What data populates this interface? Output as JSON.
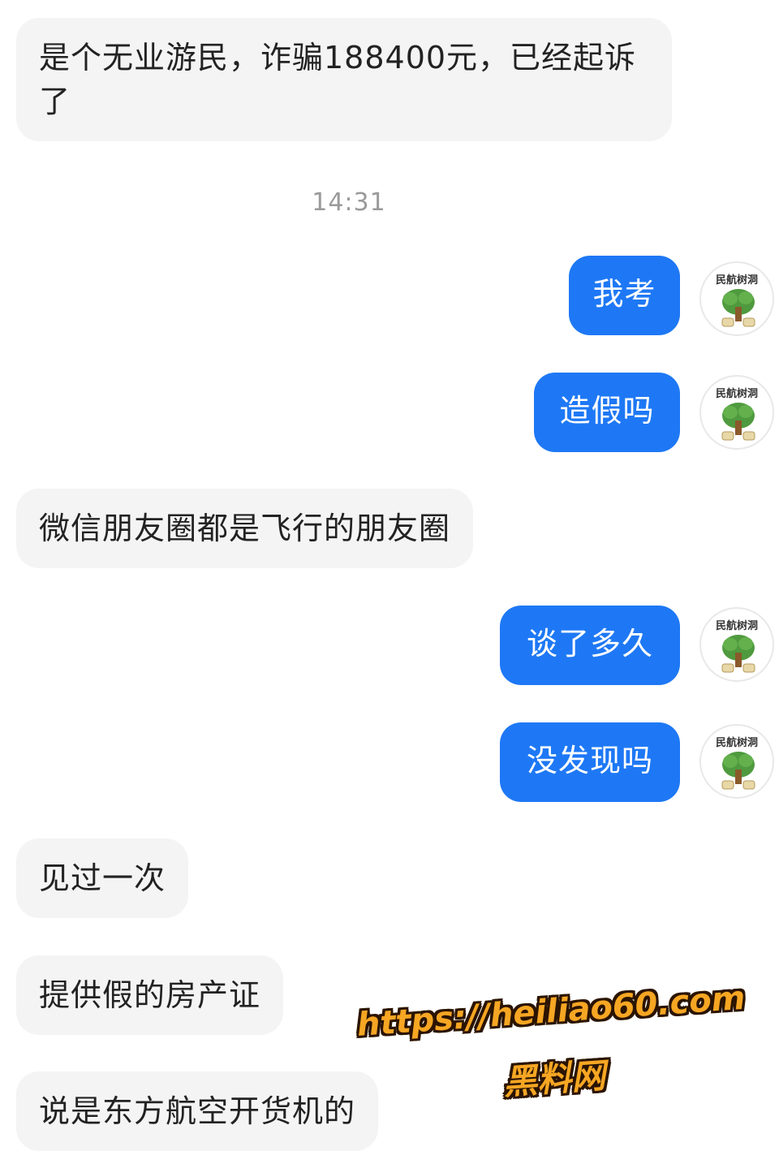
{
  "messages": [
    {
      "id": "m1",
      "side": "in",
      "text": "是个无业游民，诈骗188400元，已经起诉了"
    },
    {
      "id": "ts",
      "type": "timestamp",
      "text": "14:31"
    },
    {
      "id": "m2",
      "side": "out",
      "text": "我考"
    },
    {
      "id": "m3",
      "side": "out",
      "text": "造假吗"
    },
    {
      "id": "m4",
      "side": "in",
      "text": "微信朋友圈都是飞行的朋友圈"
    },
    {
      "id": "m5",
      "side": "out",
      "text": "谈了多久"
    },
    {
      "id": "m6",
      "side": "out",
      "text": "没发现吗"
    },
    {
      "id": "m7",
      "side": "in",
      "text": "见过一次"
    },
    {
      "id": "m8",
      "side": "in",
      "text": "提供假的房产证"
    },
    {
      "id": "m9",
      "side": "in",
      "text": "说是东方航空开货机的"
    }
  ],
  "avatar": {
    "label": "民航树洞",
    "icon": "tree-icon"
  },
  "watermark": {
    "url": "https://heiliao60.com",
    "name": "黑料网"
  },
  "colors": {
    "outgoing_bubble": "#1e78f5",
    "incoming_bubble": "#f4f4f4",
    "timestamp": "#9a9a9a",
    "watermark": "#f6a623"
  }
}
